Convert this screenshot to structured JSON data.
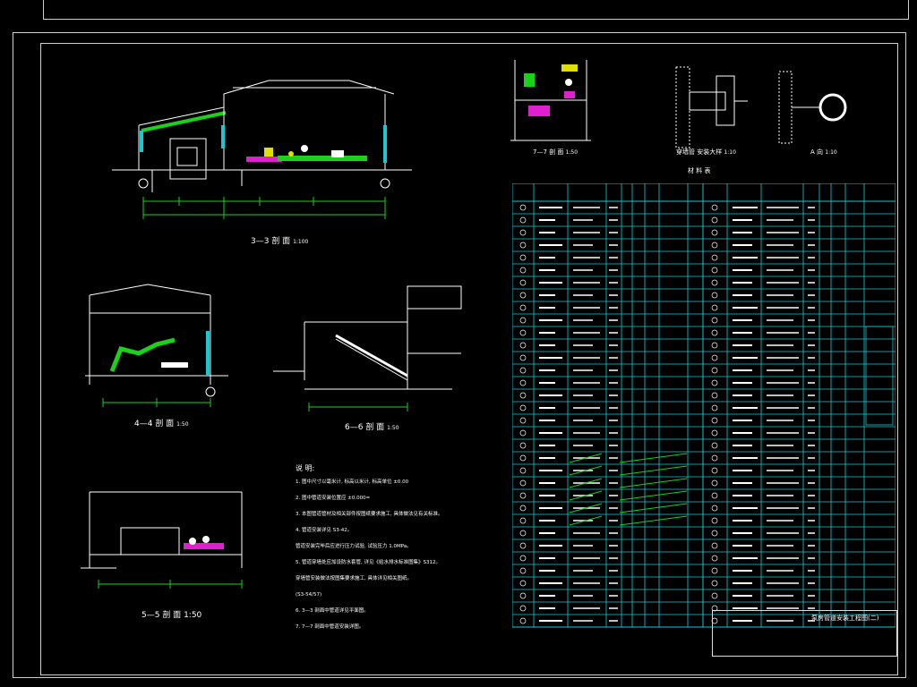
{
  "sections": {
    "s3": {
      "title": "3—3 剖 面",
      "scale": "1:100"
    },
    "s4": {
      "title": "4—4 剖 面",
      "scale": "1:50"
    },
    "s6": {
      "title": "6—6 剖 面",
      "scale": "1:50"
    },
    "s5": {
      "title": "5—5 剖 面",
      "scale": "1:50"
    },
    "s7": {
      "title": "7—7 剖 面",
      "scale": "1:50"
    },
    "detail_a": {
      "title": "穿墙管 安装大样",
      "scale": "1:10"
    },
    "detail_b": {
      "title": "A 向",
      "scale": "1:10"
    }
  },
  "table": {
    "title": "材 料 表",
    "colors": {
      "grid": "#18c9d3",
      "line": "#ffffff",
      "green": "#19d219",
      "pink": "#e020d0",
      "yellow": "#e0e000"
    }
  },
  "notes": {
    "heading": "说 明:",
    "items": [
      "1. 图中尺寸以毫米计, 标高以米计, 标高单位 ±0.00",
      "2. 图中管道安装位置应 ±0.000=",
      "3. 本图管道管材及相关部件按图纸要求施工, 具体做法见有关标准。",
      "4. 管道安装详见 S3-42。",
      "   管道安装完毕后应进行压力试验, 试验压力 1.0MPa。",
      "5. 管道穿墙处应加设防水套管, 详见《给水排水标准图集》S312。",
      "   穿墙管安装做法按图集要求施工, 具体详见相关图纸。",
      "   (S3-54/57)",
      "6. 3—3 剖面中管道详见平面图。",
      "7. 7—7 剖面中管道安装详图。"
    ]
  },
  "title_block": {
    "drawing_title": "泵房管道安装工程图(二)"
  }
}
